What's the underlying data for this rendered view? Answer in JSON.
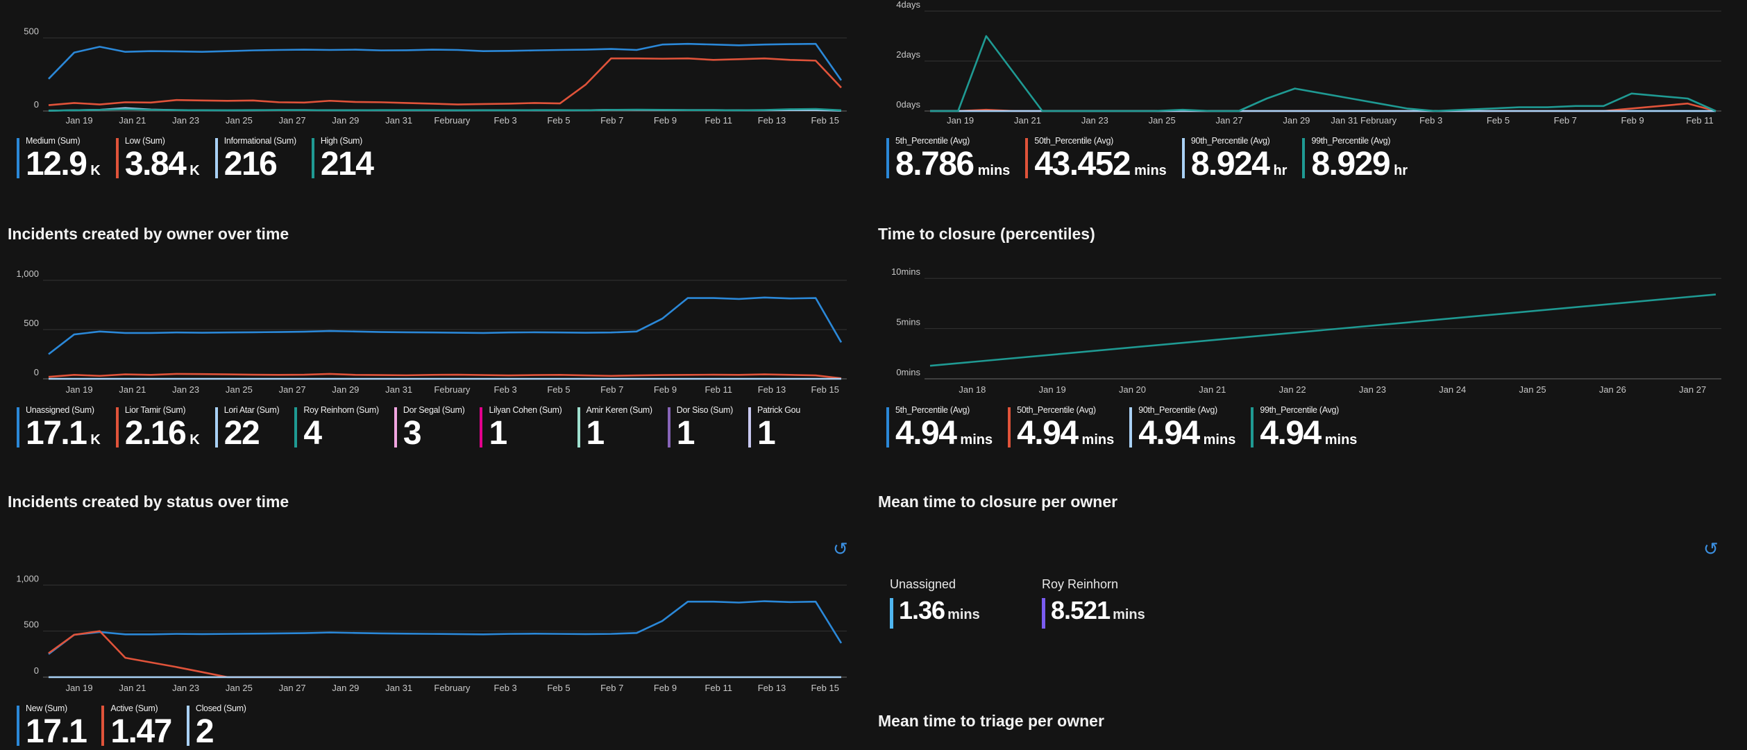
{
  "chart_data": [
    {
      "id": "severity",
      "type": "line",
      "x_ticks": [
        "Jan 19",
        "Jan 21",
        "Jan 23",
        "Jan 25",
        "Jan 27",
        "Jan 29",
        "Jan 31",
        "February",
        "Feb 3",
        "Feb 5",
        "Feb 7",
        "Feb 9",
        "Feb 11",
        "Feb 13",
        "Feb 15"
      ],
      "y_ticks": [
        "0",
        "500"
      ],
      "ylim": [
        0,
        570
      ],
      "grid": true,
      "series": [
        {
          "name": "Medium (Sum)",
          "color": "#2b88d8",
          "values": [
            220,
            400,
            440,
            405,
            410,
            408,
            405,
            410,
            415,
            418,
            420,
            418,
            420,
            415,
            416,
            420,
            418,
            410,
            412,
            415,
            418,
            420,
            425,
            418,
            455,
            460,
            455,
            450,
            455,
            458,
            460,
            210
          ]
        },
        {
          "name": "Low (Sum)",
          "color": "#e0533a",
          "values": [
            40,
            55,
            45,
            60,
            58,
            75,
            72,
            70,
            72,
            60,
            58,
            70,
            62,
            60,
            55,
            50,
            45,
            48,
            50,
            55,
            52,
            180,
            360,
            360,
            358,
            360,
            350,
            355,
            360,
            350,
            345,
            160
          ]
        },
        {
          "name": "Informational (Sum)",
          "color": "#a9d1f5",
          "values": [
            2,
            5,
            8,
            20,
            10,
            6,
            5,
            4,
            5,
            6,
            6,
            5,
            5,
            5,
            5,
            5,
            4,
            5,
            5,
            5,
            5,
            5,
            8,
            8,
            7,
            6,
            6,
            5,
            5,
            6,
            6,
            2
          ]
        },
        {
          "name": "High (Sum)",
          "color": "#1f9a93",
          "values": [
            2,
            5,
            8,
            12,
            8,
            6,
            5,
            5,
            6,
            6,
            6,
            5,
            5,
            6,
            6,
            6,
            5,
            5,
            5,
            6,
            6,
            5,
            8,
            9,
            8,
            6,
            6,
            5,
            7,
            12,
            14,
            5
          ]
        }
      ]
    },
    {
      "id": "closure_days",
      "type": "line",
      "x_ticks": [
        "Jan 19",
        "Jan 21",
        "Jan 23",
        "Jan 25",
        "Jan 27",
        "Jan 29",
        "Jan 31 February",
        "Feb 3",
        "Feb 5",
        "Feb 7",
        "Feb 9",
        "Feb 11"
      ],
      "y_ticks": [
        "0days",
        "2days",
        "4days"
      ],
      "ylim": [
        0,
        4
      ],
      "grid": true,
      "series": [
        {
          "name": "5th_Percentile (Avg)",
          "color": "#2b88d8",
          "values": [
            0,
            0,
            0,
            0,
            0,
            0,
            0,
            0,
            0,
            0,
            0,
            0,
            0,
            0,
            0,
            0,
            0,
            0,
            0,
            0,
            0,
            0,
            0,
            0,
            0,
            0,
            0,
            0
          ]
        },
        {
          "name": "50th_Percentile (Avg)",
          "color": "#e0533a",
          "values": [
            0,
            0,
            0.05,
            0,
            0,
            0,
            0,
            0,
            0,
            0,
            0,
            0,
            0,
            0,
            0,
            0,
            0,
            0,
            0,
            0,
            0,
            0,
            0,
            0,
            0,
            0.1,
            0.2,
            0.3,
            0
          ]
        },
        {
          "name": "90th_Percentile (Avg)",
          "color": "#a9d1f5",
          "values": [
            0,
            0,
            0,
            0,
            0,
            0,
            0,
            0,
            0,
            0,
            0,
            0,
            0,
            0,
            0,
            0,
            0,
            0,
            0,
            0,
            0,
            0,
            0,
            0,
            0,
            0,
            0,
            0
          ]
        },
        {
          "name": "99th_Percentile (Avg)",
          "color": "#1f9a93",
          "values": [
            0,
            0,
            3.0,
            1.5,
            0,
            0,
            0,
            0,
            0,
            0.05,
            0,
            0,
            0.5,
            0.9,
            0.7,
            0.5,
            0.3,
            0.1,
            0,
            0.05,
            0.1,
            0.15,
            0.15,
            0.2,
            0.2,
            0.7,
            0.6,
            0.5,
            0
          ]
        }
      ]
    },
    {
      "id": "owner",
      "type": "line",
      "x_ticks": [
        "Jan 19",
        "Jan 21",
        "Jan 23",
        "Jan 25",
        "Jan 27",
        "Jan 29",
        "Jan 31",
        "February",
        "Feb 3",
        "Feb 5",
        "Feb 7",
        "Feb 9",
        "Feb 11",
        "Feb 13",
        "Feb 15"
      ],
      "y_ticks": [
        "0",
        "500",
        "1,000"
      ],
      "ylim": [
        0,
        1070
      ],
      "grid": true,
      "series": [
        {
          "name": "Unassigned (Sum)",
          "color": "#2b88d8",
          "values": [
            250,
            450,
            480,
            465,
            465,
            470,
            468,
            470,
            472,
            475,
            478,
            485,
            480,
            475,
            472,
            470,
            468,
            465,
            470,
            472,
            470,
            468,
            470,
            480,
            610,
            820,
            820,
            810,
            825,
            815,
            820,
            370
          ]
        },
        {
          "name": "Lior Tamir (Sum)",
          "color": "#e0533a",
          "values": [
            20,
            40,
            30,
            45,
            40,
            50,
            48,
            45,
            42,
            40,
            42,
            50,
            40,
            38,
            36,
            40,
            42,
            38,
            35,
            38,
            40,
            35,
            30,
            35,
            38,
            40,
            42,
            40,
            45,
            40,
            35,
            5
          ]
        },
        {
          "name": "Lori Atar (Sum)",
          "color": "#a9d1f5",
          "values": [
            0,
            0,
            0,
            0,
            0,
            0,
            0,
            0,
            0,
            0,
            0,
            0,
            0,
            0,
            0,
            0,
            0,
            0,
            0,
            0,
            0,
            0,
            0,
            0,
            0,
            0,
            0,
            0,
            0,
            0,
            0,
            0
          ]
        }
      ]
    },
    {
      "id": "percentiles",
      "type": "line",
      "x_ticks": [
        "Jan 18",
        "Jan 19",
        "Jan 20",
        "Jan 21",
        "Jan 22",
        "Jan 23",
        "Jan 24",
        "Jan 25",
        "Jan 26",
        "Jan 27"
      ],
      "y_ticks": [
        "0mins",
        "5mins",
        "10mins"
      ],
      "ylim": [
        0,
        10.5
      ],
      "grid": true,
      "series": [
        {
          "name": "99th_Percentile (Avg)",
          "color": "#1f9a93",
          "values": [
            1.3,
            8.4
          ]
        }
      ]
    },
    {
      "id": "status",
      "type": "line",
      "x_ticks": [
        "Jan 19",
        "Jan 21",
        "Jan 23",
        "Jan 25",
        "Jan 27",
        "Jan 29",
        "Jan 31",
        "February",
        "Feb 3",
        "Feb 5",
        "Feb 7",
        "Feb 9",
        "Feb 11",
        "Feb 13",
        "Feb 15"
      ],
      "y_ticks": [
        "0",
        "500",
        "1,000"
      ],
      "ylim": [
        0,
        1070
      ],
      "grid": true,
      "series": [
        {
          "name": "New (Sum)",
          "color": "#2b88d8",
          "values": [
            250,
            460,
            490,
            465,
            465,
            470,
            468,
            470,
            472,
            475,
            478,
            485,
            480,
            475,
            472,
            470,
            468,
            465,
            470,
            472,
            470,
            468,
            470,
            480,
            610,
            820,
            820,
            810,
            825,
            815,
            820,
            370
          ]
        },
        {
          "name": "Active (Sum)",
          "color": "#e0533a",
          "values": [
            260,
            460,
            500,
            210,
            160,
            110,
            55,
            0,
            0,
            0,
            0,
            0
          ]
        },
        {
          "name": "Closed (Sum)",
          "color": "#a9d1f5",
          "values": [
            0,
            0,
            0,
            0,
            0,
            0,
            0,
            0,
            0,
            0,
            0,
            0,
            0,
            0,
            0,
            0,
            0,
            0,
            0,
            0,
            0,
            0,
            0,
            0,
            0,
            0,
            0,
            0,
            0,
            0,
            0,
            0
          ]
        }
      ]
    }
  ],
  "legends": {
    "severity": [
      {
        "name": "Medium (Sum)",
        "value": "12.9",
        "unit": "K",
        "color": "#2b88d8"
      },
      {
        "name": "Low (Sum)",
        "value": "3.84",
        "unit": "K",
        "color": "#e0533a"
      },
      {
        "name": "Informational (Sum)",
        "value": "216",
        "unit": "",
        "color": "#a9d1f5"
      },
      {
        "name": "High (Sum)",
        "value": "214",
        "unit": "",
        "color": "#1f9a93"
      }
    ],
    "closure_days": [
      {
        "name": "5th_Percentile (Avg)",
        "value": "8.786",
        "unit": "mins",
        "color": "#2b88d8"
      },
      {
        "name": "50th_Percentile (Avg)",
        "value": "43.452",
        "unit": "mins",
        "color": "#e0533a"
      },
      {
        "name": "90th_Percentile (Avg)",
        "value": "8.924",
        "unit": "hr",
        "color": "#a9d1f5"
      },
      {
        "name": "99th_Percentile (Avg)",
        "value": "8.929",
        "unit": "hr",
        "color": "#1f9a93"
      }
    ],
    "owner": [
      {
        "name": "Unassigned (Sum)",
        "value": "17.1",
        "unit": "K",
        "color": "#2b88d8"
      },
      {
        "name": "Lior Tamir (Sum)",
        "value": "2.16",
        "unit": "K",
        "color": "#e0533a"
      },
      {
        "name": "Lori Atar (Sum)",
        "value": "22",
        "unit": "",
        "color": "#a9d1f5"
      },
      {
        "name": "Roy Reinhorn (Sum)",
        "value": "4",
        "unit": "",
        "color": "#1f9a93"
      },
      {
        "name": "Dor Segal (Sum)",
        "value": "3",
        "unit": "",
        "color": "#f2a5e0"
      },
      {
        "name": "Lilyan Cohen (Sum)",
        "value": "1",
        "unit": "",
        "color": "#e3008c"
      },
      {
        "name": "Amir Keren (Sum)",
        "value": "1",
        "unit": "",
        "color": "#9fe0cf"
      },
      {
        "name": "Dor Siso (Sum)",
        "value": "1",
        "unit": "",
        "color": "#8764b8"
      },
      {
        "name": "Patrick Gou",
        "value": "1",
        "unit": "",
        "color": "#c8c8f0"
      }
    ],
    "percentiles": [
      {
        "name": "5th_Percentile (Avg)",
        "value": "4.94",
        "unit": "mins",
        "color": "#2b88d8"
      },
      {
        "name": "50th_Percentile (Avg)",
        "value": "4.94",
        "unit": "mins",
        "color": "#e0533a"
      },
      {
        "name": "90th_Percentile (Avg)",
        "value": "4.94",
        "unit": "mins",
        "color": "#a9d1f5"
      },
      {
        "name": "99th_Percentile (Avg)",
        "value": "4.94",
        "unit": "mins",
        "color": "#1f9a93"
      }
    ],
    "status": [
      {
        "name": "New (Sum)",
        "value": "17.1",
        "unit": "",
        "color": "#2b88d8"
      },
      {
        "name": "Active (Sum)",
        "value": "1.47",
        "unit": "",
        "color": "#e0533a"
      },
      {
        "name": "Closed (Sum)",
        "value": "2",
        "unit": "",
        "color": "#a9d1f5"
      }
    ]
  },
  "titles": {
    "owner": "Incidents created by owner over time",
    "percentiles": "Time to closure (percentiles)",
    "status": "Incidents created by status over time",
    "mean_closure": "Mean time to closure per owner",
    "mean_triage": "Mean time to triage per owner"
  },
  "mean_closure_owners": [
    {
      "name": "Unassigned",
      "value": "1.36",
      "unit": "mins",
      "color": "#4fb6f0"
    },
    {
      "name": "Roy Reinhorn",
      "value": "8.521",
      "unit": "mins",
      "color": "#7a5cf0"
    }
  ],
  "icons": {
    "refresh": "refresh-icon"
  }
}
